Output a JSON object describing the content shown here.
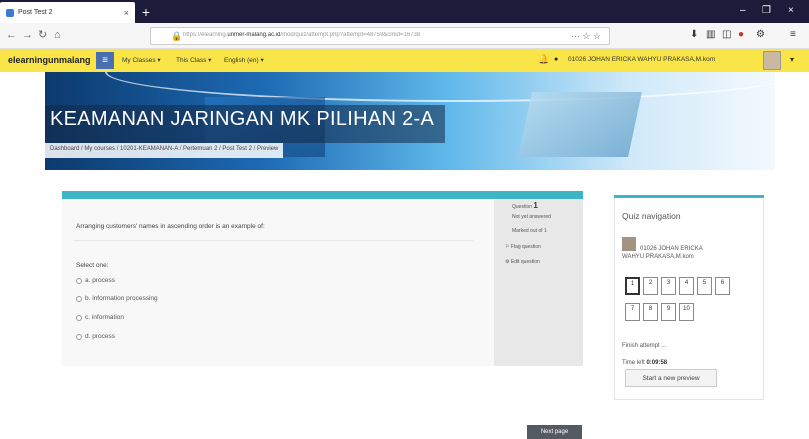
{
  "browser": {
    "tab_title": "Post Test 2",
    "tab_close": "×",
    "new_tab": "+",
    "win_min": "–",
    "win_max": "❐",
    "win_close": "×",
    "nav_back": "←",
    "nav_forward": "→",
    "nav_reload": "↻",
    "nav_home": "⌂",
    "url_prefix": "https://elearning.",
    "url_domain": "unmer-malang.ac.id",
    "url_path": "/mod/quiz/attempt.php?attempt=48759&cmid=16738",
    "url_actions": "··· ☆ ☆",
    "toolbar_icons": [
      "⬇",
      "▥",
      "◫",
      "●",
      "⚙",
      "≡"
    ]
  },
  "moodle_header": {
    "site_name": "elearningunmalang",
    "menu_icon": "≡",
    "menu_links": [
      "My Classes ▾",
      "This Class ▾",
      "English (en) ▾"
    ],
    "bell_icon": "🔔",
    "chat_icon": "●",
    "user_name": "01026 JOHAN ERICKA WAHYU PRAKASA,M.kom",
    "caret": "▾"
  },
  "banner": {
    "course_title": "KEAMANAN JARINGAN MK PILIHAN 2-A",
    "breadcrumb": "Dashboard / My courses / 10201-KEAMANAN-A / Pertemuan 2 / Post Test 2 / Preview"
  },
  "question": {
    "text": "Arranging customers' names in ascending order is an example of:",
    "select_one": "Select one:",
    "options": [
      "a. process",
      "b. information processing",
      "c. information",
      "d. process"
    ]
  },
  "question_info": {
    "label": "Question",
    "number": "1",
    "status": "Not yet answered",
    "marks": "Marked out of 1",
    "flag": "Flag question",
    "edit": "Edit question"
  },
  "next_label": "Next page",
  "quiz_nav": {
    "title": "Quiz navigation",
    "user_line1": "01026 JOHAN ERICKA",
    "user_line2": "WAHYU PRAKASA,M.kom",
    "numbers": [
      "1",
      "2",
      "3",
      "4",
      "5",
      "6",
      "7",
      "8",
      "9",
      "10"
    ],
    "finish": "Finish attempt ...",
    "time_label": "Time left",
    "time_value": "0:09:58",
    "preview_button": "Start a new preview"
  }
}
